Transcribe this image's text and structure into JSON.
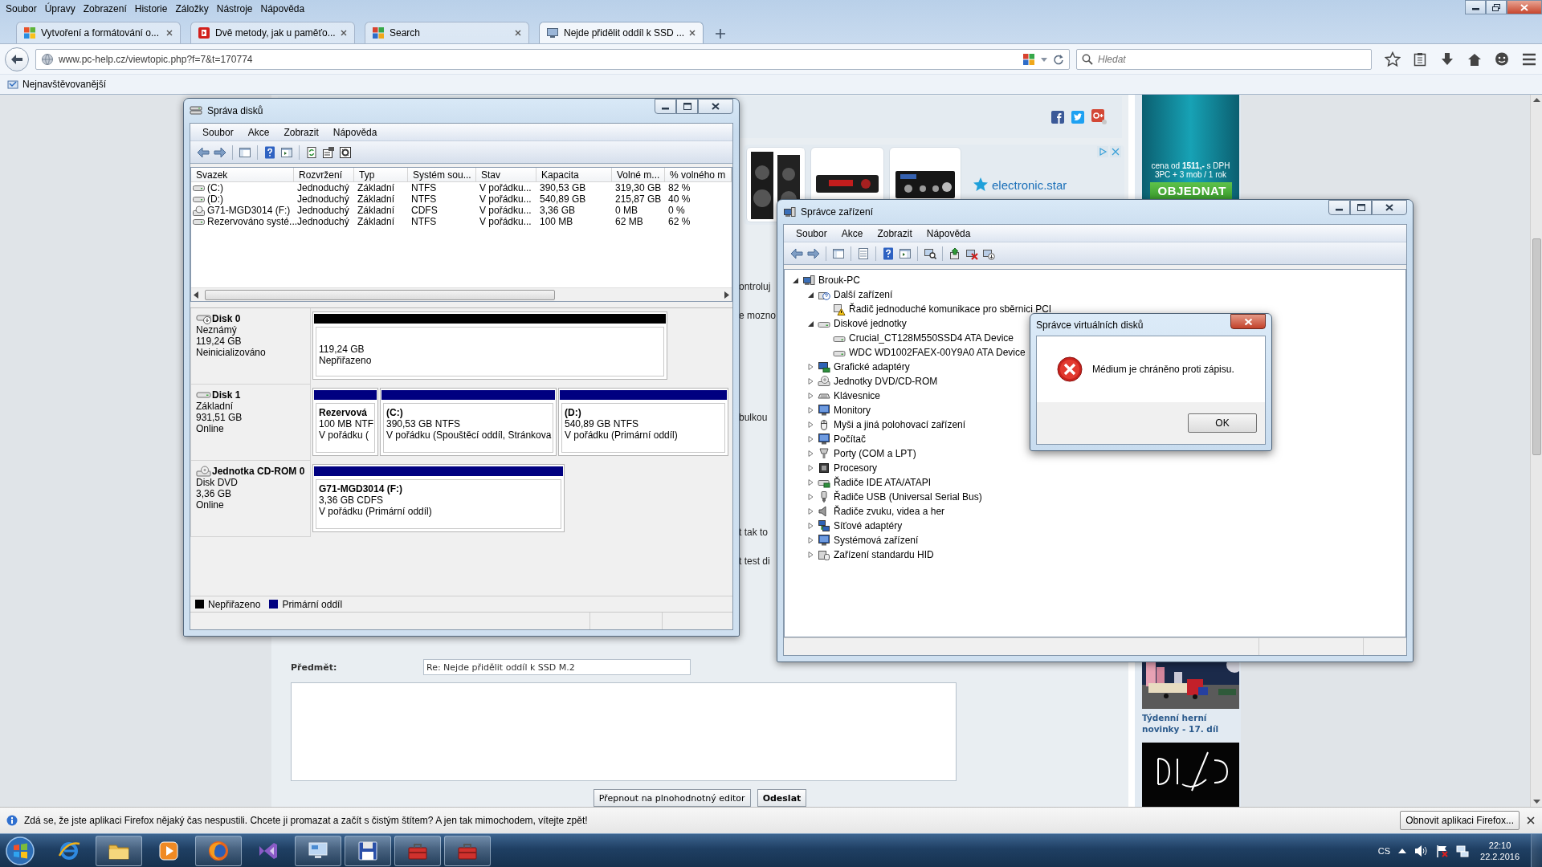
{
  "menu_bar": [
    "Soubor",
    "Úpravy",
    "Zobrazení",
    "Historie",
    "Záložky",
    "Nástroje",
    "Nápověda"
  ],
  "tabs": [
    {
      "title": "Vytvoření a formátování o...",
      "kind": "windows",
      "selected": false
    },
    {
      "title": "Dvě metody, jak u paměťo...",
      "kind": "video",
      "selected": false
    },
    {
      "title": "Search",
      "kind": "search",
      "selected": false
    },
    {
      "title": "Nejde přidělit oddíl k SSD ...",
      "kind": "forum",
      "selected": true
    }
  ],
  "address_bar": {
    "url": "www.pc-help.cz/viewtopic.php?f=7&t=170774"
  },
  "search_bar": {
    "placeholder": "Hledat"
  },
  "bookmarks": [
    {
      "label": "Nejnavštěvovanější"
    }
  ],
  "page": {
    "ad_banner": {
      "logo": "electronic.star"
    },
    "fragments": [
      "ontroluj",
      "e mozno",
      "bulkou",
      "t tak to",
      "t test di"
    ],
    "reply_form": {
      "subject_label": "Předmět:",
      "subject_value": "Re: Nejde přidělit oddíl k SSD M.2",
      "buttons": [
        {
          "label": "Přepnout na plnohodnotný editor",
          "kind": "default"
        },
        {
          "label": "Odeslat",
          "kind": "primary"
        }
      ]
    },
    "sidebar": {
      "ad": {
        "price_line": "cena od **1511,-** s DPH",
        "offer_line": "3PC + 3 mob / 1 rok",
        "button": "OBJEDNAT"
      },
      "article": {
        "title": "Týdenní herní novinky - 17. díl"
      }
    }
  },
  "disk_management": {
    "title": "Správa disků",
    "menu": [
      "Soubor",
      "Akce",
      "Zobrazit",
      "Nápověda"
    ],
    "columns": [
      "Svazek",
      "Rozvržení",
      "Typ",
      "Systém sou...",
      "Stav",
      "Kapacita",
      "Volné m...",
      "% volného m"
    ],
    "volumes": [
      {
        "kind": "hdd",
        "cells": [
          "(C:)",
          "Jednoduchý",
          "Základní",
          "NTFS",
          "V pořádku...",
          "390,53 GB",
          "319,30 GB",
          "82 %"
        ]
      },
      {
        "kind": "hdd",
        "cells": [
          "(D:)",
          "Jednoduchý",
          "Základní",
          "NTFS",
          "V pořádku...",
          "540,89 GB",
          "215,87 GB",
          "40 %"
        ]
      },
      {
        "kind": "cdrom",
        "cells": [
          "G71-MGD3014 (F:)",
          "Jednoduchý",
          "Základní",
          "CDFS",
          "V pořádku...",
          "3,36 GB",
          "0 MB",
          "0 %"
        ]
      },
      {
        "kind": "hdd",
        "cells": [
          "Rezervováno systé...",
          "Jednoduchý",
          "Základní",
          "NTFS",
          "V pořádku...",
          "100 MB",
          "62 MB",
          "62 %"
        ]
      }
    ],
    "disks": [
      {
        "name": "Disk 0",
        "kind": "uninitialized",
        "lines": [
          "Neznámý",
          "119,24 GB",
          "Neinicializováno"
        ],
        "partitions": [
          {
            "kind": "unallocated",
            "lines": [
              "119,24 GB",
              "Nepřiřazeno"
            ]
          }
        ]
      },
      {
        "name": "Disk 1",
        "kind": "basic",
        "lines": [
          "Základní",
          "931,51 GB",
          "Online"
        ],
        "partitions": [
          {
            "kind": "primary",
            "title": "Rezervová",
            "lines": [
              "100 MB NTF",
              "V pořádku ("
            ]
          },
          {
            "kind": "primary",
            "title": "(C:)",
            "lines": [
              "390,53 GB NTFS",
              "V pořádku (Spouštěcí oddíl, Stránkova"
            ]
          },
          {
            "kind": "primary",
            "title": "(D:)",
            "lines": [
              "540,89 GB NTFS",
              "V pořádku (Primární oddíl)"
            ]
          }
        ]
      },
      {
        "name": "Jednotka CD-ROM 0",
        "kind": "dvd",
        "lines": [
          "Disk DVD",
          "3,36 GB",
          "Online"
        ],
        "partitions": [
          {
            "kind": "primary",
            "title": "G71-MGD3014  (F:)",
            "lines": [
              "3,36 GB CDFS",
              "V pořádku (Primární oddíl)"
            ]
          }
        ]
      }
    ],
    "legend": [
      {
        "label": "Nepřiřazeno",
        "color": "#000000"
      },
      {
        "label": "Primární oddíl",
        "color": "#000080"
      }
    ]
  },
  "device_manager": {
    "title": "Správce zařízení",
    "menu": [
      "Soubor",
      "Akce",
      "Zobrazit",
      "Nápověda"
    ],
    "tree": [
      {
        "label": "Brouk-PC",
        "kind": "computer",
        "expanded": true,
        "children": [
          {
            "label": "Další zařízení",
            "kind": "unknown",
            "expanded": true,
            "children": [
              {
                "label": "Řadič jednoduché komunikace pro sběrnici PCI",
                "kind": "warning"
              }
            ]
          },
          {
            "label": "Diskové jednotky",
            "kind": "disk",
            "expanded": true,
            "children": [
              {
                "label": "Crucial_CT128M550SSD4 ATA Device",
                "kind": "disk"
              },
              {
                "label": "WDC WD1002FAEX-00Y9A0 ATA Device",
                "kind": "disk"
              }
            ]
          },
          {
            "label": "Grafické adaptéry",
            "kind": "display",
            "expanded": false
          },
          {
            "label": "Jednotky DVD/CD-ROM",
            "kind": "dvd",
            "expanded": false
          },
          {
            "label": "Klávesnice",
            "kind": "keyboard",
            "expanded": false
          },
          {
            "label": "Monitory",
            "kind": "monitor",
            "expanded": false
          },
          {
            "label": "Myši a jiná polohovací zařízení",
            "kind": "mouse",
            "expanded": false
          },
          {
            "label": "Počítač",
            "kind": "monitor",
            "expanded": false
          },
          {
            "label": "Porty (COM a LPT)",
            "kind": "port",
            "expanded": false
          },
          {
            "label": "Procesory",
            "kind": "cpu",
            "expanded": false
          },
          {
            "label": "Řadiče IDE ATA/ATAPI",
            "kind": "ide",
            "expanded": false
          },
          {
            "label": "Řadiče USB (Universal Serial Bus)",
            "kind": "usb",
            "expanded": false
          },
          {
            "label": "Řadiče zvuku, videa a her",
            "kind": "sound",
            "expanded": false
          },
          {
            "label": "Síťové adaptéry",
            "kind": "network",
            "expanded": false
          },
          {
            "label": "Systémová zařízení",
            "kind": "monitor",
            "expanded": false
          },
          {
            "label": "Zařízení standardu HID",
            "kind": "hid",
            "expanded": false
          }
        ]
      }
    ]
  },
  "dialog": {
    "title": "Správce virtuálních disků",
    "message": "Médium je chráněno proti zápisu.",
    "button": "OK"
  },
  "notification": {
    "message": "Zdá se, že jste aplikaci Firefox nějaký čas nespustili. Chcete ji promazat a začít s čistým štítem? A jen tak mimochodem, vítejte zpět!",
    "button": "Obnovit aplikaci Firefox..."
  },
  "taskbar": {
    "apps": [
      {
        "kind": "ie",
        "running": false
      },
      {
        "kind": "folder",
        "running": true
      },
      {
        "kind": "media",
        "running": false
      },
      {
        "kind": "firefox",
        "running": true
      },
      {
        "kind": "vs",
        "running": false
      },
      {
        "kind": "monitor",
        "running": true
      },
      {
        "kind": "floppy",
        "running": true
      },
      {
        "kind": "toolbox",
        "running": true
      },
      {
        "kind": "toolbox",
        "running": true
      }
    ],
    "language": "CS",
    "time": "22:10",
    "date": "22.2.2016"
  }
}
